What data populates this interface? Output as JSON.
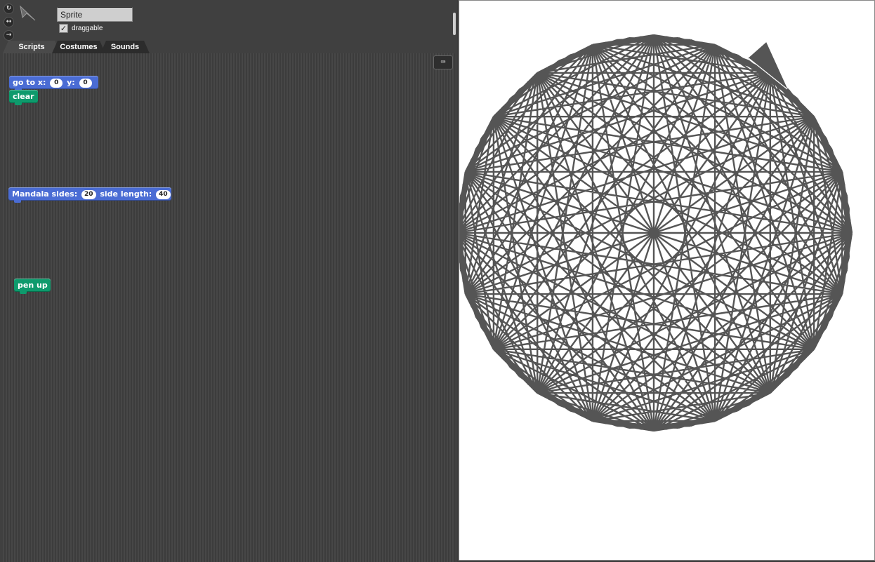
{
  "sprite": {
    "name": "Sprite",
    "draggable_label": "draggable",
    "draggable_checked": "✓",
    "rotation_buttons": [
      "↻",
      "↔",
      "→"
    ]
  },
  "tabs": [
    {
      "label": "Scripts",
      "active": true
    },
    {
      "label": "Costumes",
      "active": false
    },
    {
      "label": "Sounds",
      "active": false
    }
  ],
  "keyboard_icon": "⌨",
  "scripts": {
    "goto": {
      "label_a": "go to x:",
      "x": "0",
      "label_b": "y:",
      "y": "0"
    },
    "clear": {
      "label": "clear"
    },
    "mandala": {
      "label_a": "Mandala sides:",
      "sides": "20",
      "label_b": "side length:",
      "length": "40"
    },
    "pen_up": {
      "label": "pen up"
    }
  },
  "colors": {
    "motion": "#4a6cd4",
    "pen": "#0e9a6c",
    "stage_bg": "#ffffff",
    "pen_line": "#555555"
  },
  "drawing": {
    "sides": 20,
    "side_length": 40,
    "rings": 20
  }
}
